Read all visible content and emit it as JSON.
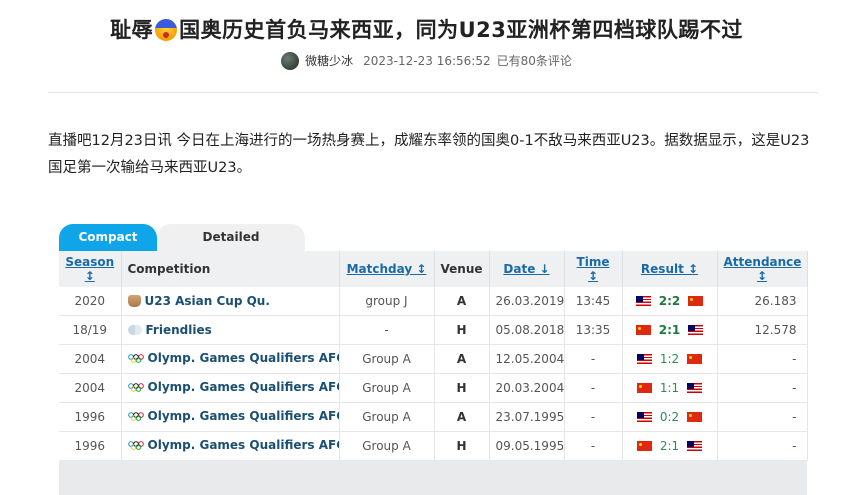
{
  "article": {
    "title_part1": "耻辱",
    "title_part2": "国奥历史首负马来西亚，同为U23亚洲杯第四档球队踢不过",
    "author": "微糖少冰",
    "datetime": "2023-12-23 16:56:52",
    "comments": "已有80条评论",
    "paragraph": "直播吧12月23日讯 今日在上海进行的一场热身赛上，成耀东率领的国奥0-1不敌马来西亚U23。据数据显示，这是U23国足第一次输给马来西亚U23。"
  },
  "tabs": [
    {
      "label": "Compact",
      "active": true
    },
    {
      "label": "Detailed",
      "active": false
    }
  ],
  "table": {
    "headers": {
      "season": "Season ↕",
      "competition": "Competition",
      "matchday": "Matchday ↕",
      "venue": "Venue",
      "date": "Date ↓",
      "time": "Time ↕",
      "result": "Result ↕",
      "attendance": "Attendance ↕"
    },
    "rows": [
      {
        "season": "2020",
        "icon": "trophy-icon",
        "competition": "U23 Asian Cup Qu.",
        "matchday": "group J",
        "venue": "A",
        "date": "26.03.2019",
        "time": "13:45",
        "flag1": "malaysia",
        "score": "2:2",
        "flag2": "china",
        "bold": true,
        "attendance": "26.183"
      },
      {
        "season": "18/19",
        "icon": "handshake-icon",
        "competition": "Friendlies",
        "matchday": "-",
        "venue": "H",
        "date": "05.08.2018",
        "time": "13:35",
        "flag1": "china",
        "score": "2:1",
        "flag2": "malaysia",
        "bold": true,
        "attendance": "12.578"
      },
      {
        "season": "2004",
        "icon": "olympic-rings-icon",
        "competition": "Olymp. Games Qualifiers AFC",
        "matchday": "Group A",
        "venue": "A",
        "date": "12.05.2004",
        "time": "-",
        "flag1": "malaysia",
        "score": "1:2",
        "flag2": "china",
        "bold": false,
        "attendance": "-"
      },
      {
        "season": "2004",
        "icon": "olympic-rings-icon",
        "competition": "Olymp. Games Qualifiers AFC",
        "matchday": "Group A",
        "venue": "H",
        "date": "20.03.2004",
        "time": "-",
        "flag1": "china",
        "score": "1:1",
        "flag2": "malaysia",
        "bold": false,
        "attendance": "-"
      },
      {
        "season": "1996",
        "icon": "olympic-rings-icon",
        "competition": "Olymp. Games Qualifiers AFC",
        "matchday": "Group A",
        "venue": "A",
        "date": "23.07.1995",
        "time": "-",
        "flag1": "malaysia",
        "score": "0:2",
        "flag2": "china",
        "bold": false,
        "attendance": "-"
      },
      {
        "season": "1996",
        "icon": "olympic-rings-icon",
        "competition": "Olymp. Games Qualifiers AFC",
        "matchday": "Group A",
        "venue": "H",
        "date": "09.05.1995",
        "time": "-",
        "flag1": "china",
        "score": "2:1",
        "flag2": "malaysia",
        "bold": false,
        "attendance": "-"
      }
    ]
  }
}
